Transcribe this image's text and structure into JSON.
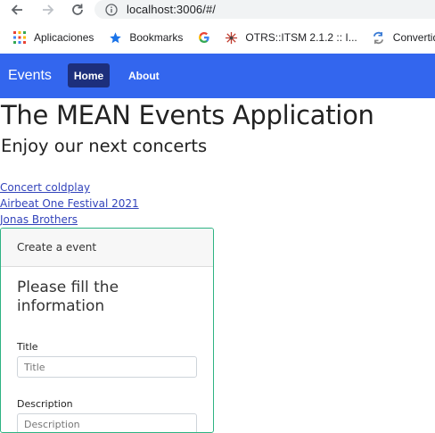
{
  "browser": {
    "url": "localhost:3006/#/",
    "bookmarks": [
      {
        "label": "Aplicaciones",
        "icon": "apps-grid-icon"
      },
      {
        "label": "Bookmarks",
        "icon": "star-icon"
      },
      {
        "label": "",
        "icon": "google-icon"
      },
      {
        "label": "OTRS::ITSM 2.1.2 :: I...",
        "icon": "otrs-icon"
      },
      {
        "label": "Convertidor",
        "icon": "converter-icon"
      }
    ]
  },
  "navbar": {
    "brand": "Events",
    "links": [
      {
        "label": "Home",
        "active": true
      },
      {
        "label": "About",
        "active": false
      }
    ],
    "colors": {
      "bar": "#3366ee",
      "active": "#1d2f7c"
    }
  },
  "main": {
    "title": "The MEAN Events Application",
    "subtitle": "Enjoy our next concerts",
    "events": [
      {
        "label": "Concert coldplay"
      },
      {
        "label": "Airbeat One Festival 2021"
      },
      {
        "label": "Jonas Brothers"
      }
    ]
  },
  "form": {
    "header": "Create a event",
    "heading": "Please fill the information",
    "fields": {
      "title": {
        "label": "Title",
        "placeholder": "Title",
        "value": ""
      },
      "description": {
        "label": "Description",
        "placeholder": "Description",
        "value": ""
      }
    },
    "accent": "#2eb383"
  }
}
